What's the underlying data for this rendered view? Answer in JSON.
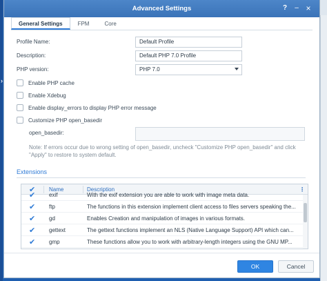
{
  "window": {
    "title": "Advanced Settings"
  },
  "tabs": [
    {
      "label": "General Settings",
      "active": true
    },
    {
      "label": "FPM",
      "active": false
    },
    {
      "label": "Core",
      "active": false
    }
  ],
  "form": {
    "profile_name_label": "Profile Name:",
    "profile_name_value": "Default Profile",
    "description_label": "Description:",
    "description_value": "Default PHP 7.0 Profile",
    "php_version_label": "PHP version:",
    "php_version_value": "PHP 7.0"
  },
  "options": [
    {
      "label": "Enable PHP cache",
      "checked": false
    },
    {
      "label": "Enable Xdebug",
      "checked": false
    },
    {
      "label": "Enable display_errors to display PHP error message",
      "checked": false
    },
    {
      "label": "Customize PHP open_basedir",
      "checked": false
    }
  ],
  "open_basedir": {
    "label": "open_basedir:",
    "value": ""
  },
  "note": "Note: If errors occur due to wrong setting of open_basedir, uncheck \"Customize PHP open_basedir\" and click \"Apply\" to restore to system default.",
  "extensions": {
    "title": "Extensions",
    "columns": {
      "name": "Name",
      "description": "Description"
    },
    "rows": [
      {
        "name": "exif",
        "description": "With the exif extension you are able to work with image meta data.",
        "checked": true
      },
      {
        "name": "ftp",
        "description": "The functions in this extension implement client access to files servers speaking the...",
        "checked": true
      },
      {
        "name": "gd",
        "description": "Enables Creation and manipulation of images in various formats.",
        "checked": true
      },
      {
        "name": "gettext",
        "description": "The gettext functions implement an NLS (Native Language Support) API which can...",
        "checked": true
      },
      {
        "name": "gmp",
        "description": "These functions allow you to work with arbitrary-length integers using the GNU MP...",
        "checked": true
      }
    ]
  },
  "buttons": {
    "ok": "OK",
    "cancel": "Cancel"
  },
  "colors": {
    "accent": "#2f7bd6",
    "titlebar": "#3a73b8",
    "ok_button": "#2f85e2"
  }
}
